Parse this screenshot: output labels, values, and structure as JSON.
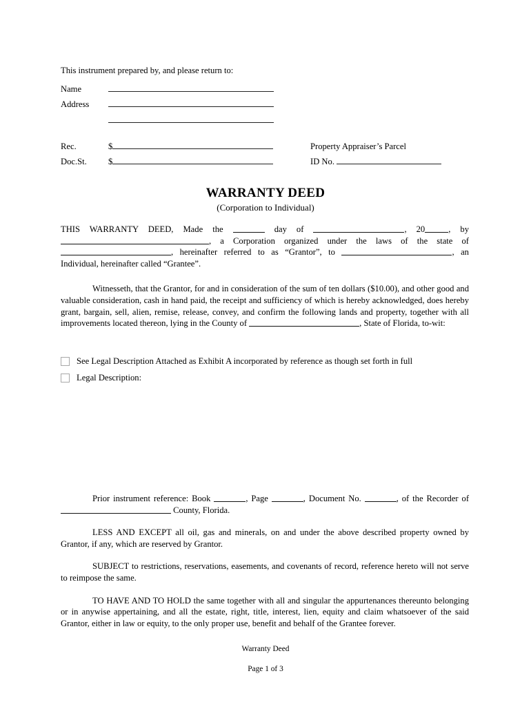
{
  "header": {
    "prepared_by_line": "This instrument prepared by, and please return to:",
    "name_label": "Name",
    "address_label": "Address",
    "rec_label": "Rec.",
    "docst_label": "Doc.St.",
    "dollar_sign": "$",
    "appraiser_line1": "Property Appraiser’s Parcel",
    "appraiser_id_label": "ID No."
  },
  "title": {
    "main": "WARRANTY DEED",
    "subtitle": "(Corporation to Individual)"
  },
  "body": {
    "para1": {
      "seg1": "THIS WARRANTY DEED, Made the",
      "seg2": "day of",
      "seg3": ", 20",
      "seg4": ", by",
      "seg5": ", a Corporation organized under the laws of the state of",
      "seg6": ", hereinafter referred to as “Grantor”, to",
      "seg7": ", an Individual, hereinafter called “Grantee”."
    },
    "para2": {
      "seg1": "Witnesseth, that the Grantor, for and in consideration of the sum of ten dollars ($10.00), and other good and valuable consideration, cash in hand paid, the receipt and sufficiency of which is hereby acknowledged, does hereby grant, bargain, sell, alien, remise, release, convey, and confirm the following lands and property, together with all improvements located thereon, lying in the County of",
      "seg2": ", State of Florida, to-wit:"
    }
  },
  "checkboxes": [
    {
      "label": "See Legal Description Attached as Exhibit A incorporated by reference as though set forth in full",
      "checked": false
    },
    {
      "label": "Legal Description:",
      "checked": false
    }
  ],
  "lower": {
    "prior": {
      "seg1": "Prior instrument reference: Book",
      "seg2": ", Page",
      "seg3": ", Document No.",
      "seg4": ", of the Recorder of",
      "seg5": "County, Florida."
    },
    "less_except": "LESS AND EXCEPT all oil, gas and minerals, on and under the above described property owned by Grantor, if any, which are reserved by Grantor.",
    "subject": "SUBJECT to restrictions, reservations, easements, and covenants of record, reference hereto will not serve to reimpose the same.",
    "habendum": "TO HAVE AND TO HOLD the same together with all and singular the appurtenances thereunto belonging or in anywise appertaining, and all the estate, right, title, interest, lien, equity and claim whatsoever of the said Grantor, either in law or equity, to the only proper use, benefit and behalf of the Grantee forever."
  },
  "footer": {
    "doc_name": "Warranty Deed",
    "page_indicator": "Page 1 of 3"
  }
}
